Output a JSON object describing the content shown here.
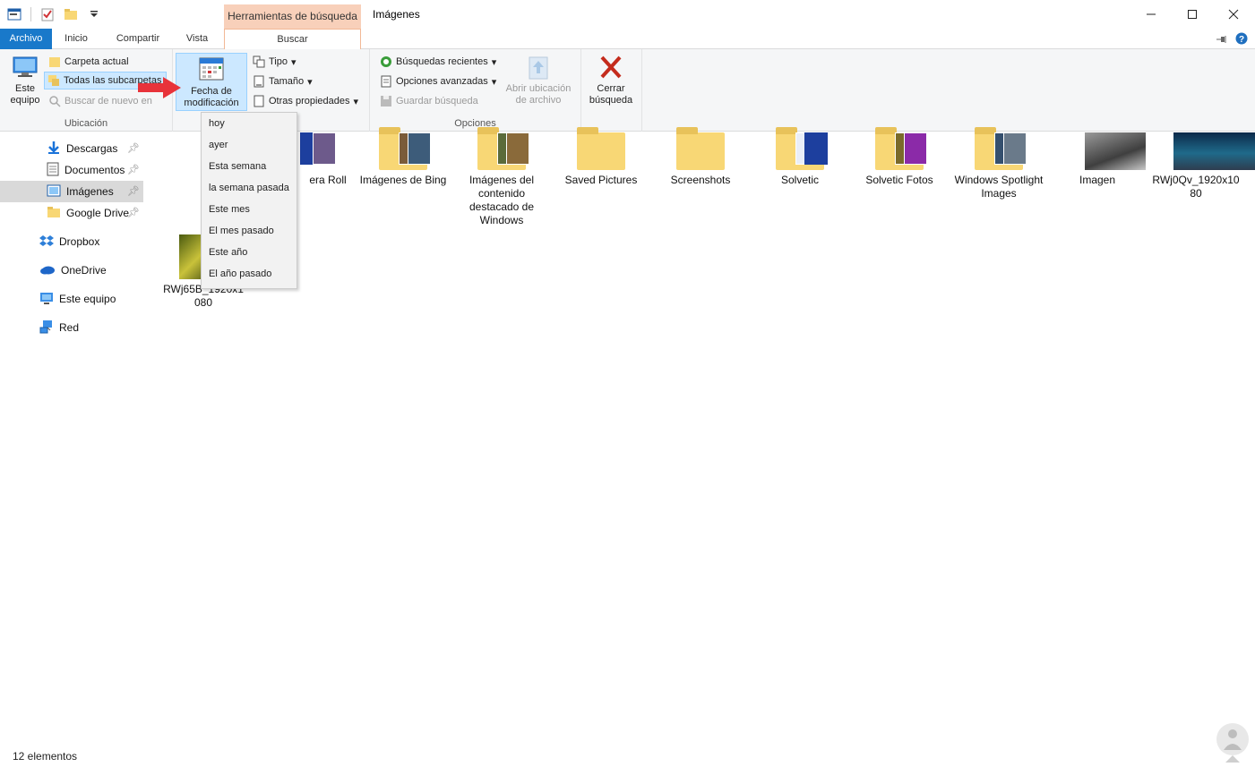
{
  "window": {
    "title": "Imágenes",
    "contextual_tab_header": "Herramientas de búsqueda"
  },
  "tabs": [
    "Archivo",
    "Inicio",
    "Compartir",
    "Vista",
    "Buscar"
  ],
  "ribbon": {
    "ubicacion": {
      "label": "Ubicación",
      "este_equipo": "Este equipo",
      "carpeta_actual": "Carpeta actual",
      "todas_subcarpetas": "Todas las subcarpetas",
      "buscar_de_nuevo": "Buscar de nuevo en"
    },
    "refinar": {
      "fecha_modificacion": "Fecha de modificación",
      "tipo": "Tipo",
      "tamano": "Tamaño",
      "otras_propiedades": "Otras propiedades"
    },
    "opciones": {
      "label": "Opciones",
      "busquedas_recientes": "Búsquedas recientes",
      "opciones_avanzadas": "Opciones avanzadas",
      "guardar_busqueda": "Guardar búsqueda",
      "abrir_ubicacion": "Abrir ubicación de archivo",
      "cerrar_busqueda": "Cerrar búsqueda"
    }
  },
  "date_menu": [
    "hoy",
    "ayer",
    "Esta semana",
    "la semana pasada",
    "Este mes",
    "El mes pasado",
    "Este año",
    "El año pasado"
  ],
  "nav": {
    "quick": [
      {
        "label": "Descargas",
        "icon": "download-arrow-icon"
      },
      {
        "label": "Documentos",
        "icon": "document-icon"
      },
      {
        "label": "Imágenes",
        "icon": "pictures-icon"
      },
      {
        "label": "Google Drive",
        "icon": "folder-icon"
      }
    ],
    "roots": [
      {
        "label": "Dropbox",
        "icon": "dropbox-icon"
      },
      {
        "label": "OneDrive",
        "icon": "onedrive-cloud-icon"
      },
      {
        "label": "Este equipo",
        "icon": "computer-icon"
      },
      {
        "label": "Red",
        "icon": "network-icon"
      }
    ]
  },
  "items": [
    {
      "label": "Camera Roll",
      "visible": "era Roll"
    },
    {
      "label": "Imágenes de Bing"
    },
    {
      "label": "Imágenes del contenido destacado de Windows"
    },
    {
      "label": "Saved Pictures"
    },
    {
      "label": "Screenshots"
    },
    {
      "label": "Solvetic"
    },
    {
      "label": "Solvetic Fotos"
    },
    {
      "label": "Windows Spotlight Images"
    },
    {
      "label": "Imagen"
    },
    {
      "label": "RWj0Qv_1920x1080"
    },
    {
      "label": "RWj65B_1920x1080"
    }
  ],
  "status": "12 elementos",
  "colors": {
    "accent": "#1979ca",
    "contextual": "#f8d0ba",
    "selection": "#cce8ff",
    "close_red": "#c42b1c",
    "annotation_arrow": "#e8333a"
  }
}
